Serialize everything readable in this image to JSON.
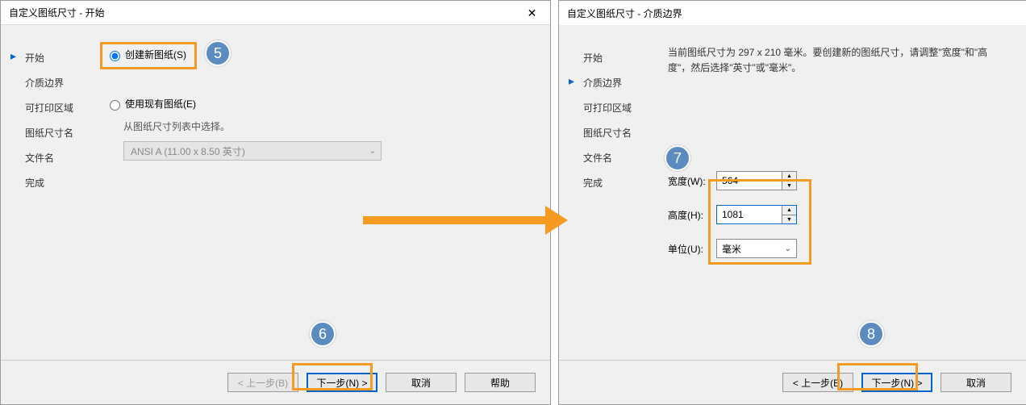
{
  "left": {
    "title": "自定义图纸尺寸 - 开始",
    "close": "✕",
    "sidebar": [
      "开始",
      "介质边界",
      "可打印区域",
      "图纸尺寸名",
      "文件名",
      "完成"
    ],
    "activeIndex": 0,
    "radio1": "创建新图纸(S)",
    "radio2": "使用现有图纸(E)",
    "helptext": "从图纸尺寸列表中选择。",
    "select": "ANSI A (11.00 x 8.50 英寸)",
    "footer": {
      "back": "< 上一步(B)",
      "next": "下一步(N) >",
      "cancel": "取消",
      "help": "帮助"
    }
  },
  "right": {
    "title": "自定义图纸尺寸 - 介质边界",
    "sidebar": [
      "开始",
      "介质边界",
      "可打印区域",
      "图纸尺寸名",
      "文件名",
      "完成"
    ],
    "activeIndex": 1,
    "instr": "当前图纸尺寸为 297 x 210 毫米。要创建新的图纸尺寸，请调整\"宽度\"和\"高度\"，然后选择\"英寸\"或\"毫米\"。",
    "widthLabel": "宽度(W):",
    "heightLabel": "高度(H):",
    "unitLabel": "单位(U):",
    "widthVal": "564",
    "heightVal": "1081",
    "unitVal": "毫米",
    "footer": {
      "back": "< 上一步(B)",
      "next": "下一步(N) >",
      "cancel": "取消"
    }
  },
  "badges": {
    "b5": "5",
    "b6": "6",
    "b7": "7",
    "b8": "8"
  }
}
